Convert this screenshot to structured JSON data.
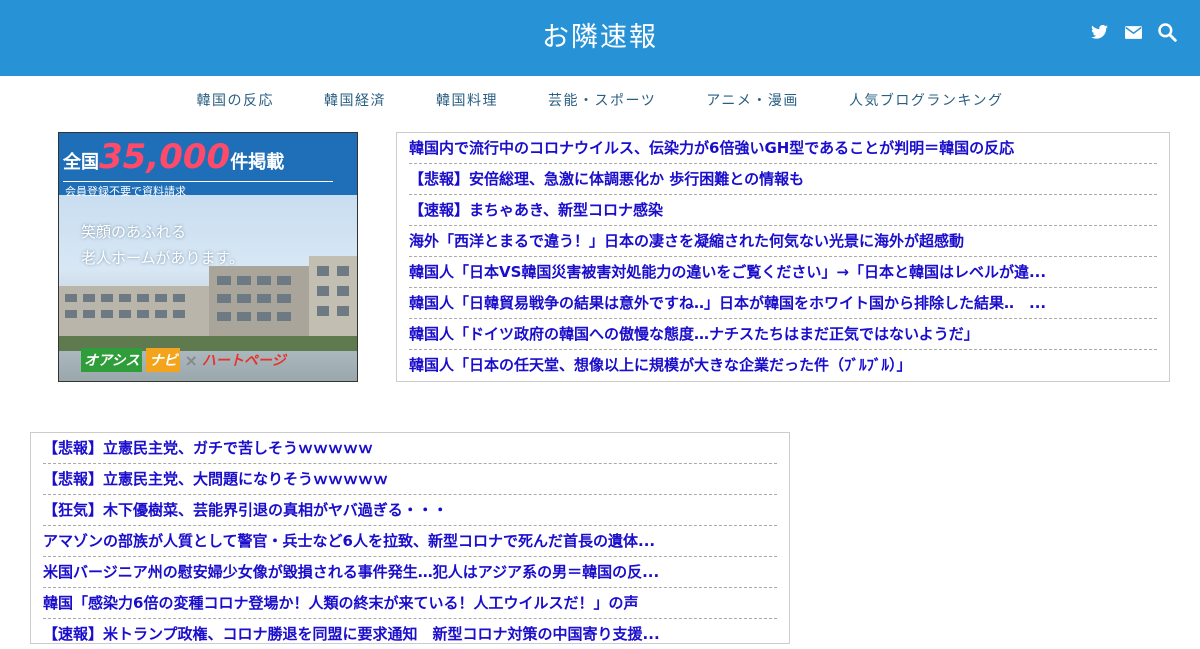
{
  "header": {
    "title": "お隣速報",
    "icons": [
      "twitter-icon",
      "mail-icon",
      "search-icon"
    ],
    "bg_color": "#2793d6"
  },
  "nav": {
    "items": [
      {
        "label": "韓国の反応"
      },
      {
        "label": "韓国経済"
      },
      {
        "label": "韓国料理"
      },
      {
        "label": "芸能・スポーツ"
      },
      {
        "label": "アニメ・漫画"
      },
      {
        "label": "人気ブログランキング"
      }
    ]
  },
  "ad": {
    "prefix": "全国",
    "number": "35,000",
    "suffix": "件掲載",
    "sub": "会員登録不要で資料請求",
    "body_line1": "笑顔のあふれる",
    "body_line2": "老人ホームがあります。",
    "logo1": "オアシス",
    "logo2": "ナビ",
    "logo_x": "×",
    "logo3": "ハートページ"
  },
  "top_links": [
    "韓国内で流行中のコロナウイルス、伝染力が6倍強いGH型であることが判明＝韓国の反応",
    "【悲報】安倍総理、急激に体調悪化か 歩行困難との情報も",
    "【速報】まちゃあき、新型コロナ感染",
    "海外「西洋とまるで違う！」日本の凄さを凝縮された何気ない光景に海外が超感動",
    "韓国人「日本VS韓国災害被害対処能力の違いをご覧ください」→「日本と韓国はレベルが違...",
    "韓国人「日韓貿易戦争の結果は意外ですね‥」日本が韓国をホワイト国から排除した結果‥　...",
    "韓国人「ドイツ政府の韓国への傲慢な態度…ナチスたちはまだ正気ではないようだ」",
    "韓国人「日本の任天堂、想像以上に規模が大きな企業だった件（ﾌﾞﾙﾌﾞﾙ）」"
  ],
  "bottom_links": [
    "【悲報】立憲民主党、ガチで苦しそうｗｗｗｗｗ",
    "【悲報】立憲民主党、大問題になりそうｗｗｗｗｗ",
    "【狂気】木下優樹菜、芸能界引退の真相がヤバ過ぎる・・・",
    "アマゾンの部族が人質として警官・兵士など6人を拉致、新型コロナで死んだ首長の遺体...",
    "米国バージニア州の慰安婦少女像が毀損される事件発生…犯人はアジア系の男＝韓国の反...",
    "韓国「感染力6倍の変種コロナ登場か！人類の終末が来ている！人工ウイルスだ！」の声",
    "【速報】米トランプ政権、コロナ勝退を同盟に要求通知　新型コロナ対策の中国寄り支援..."
  ]
}
